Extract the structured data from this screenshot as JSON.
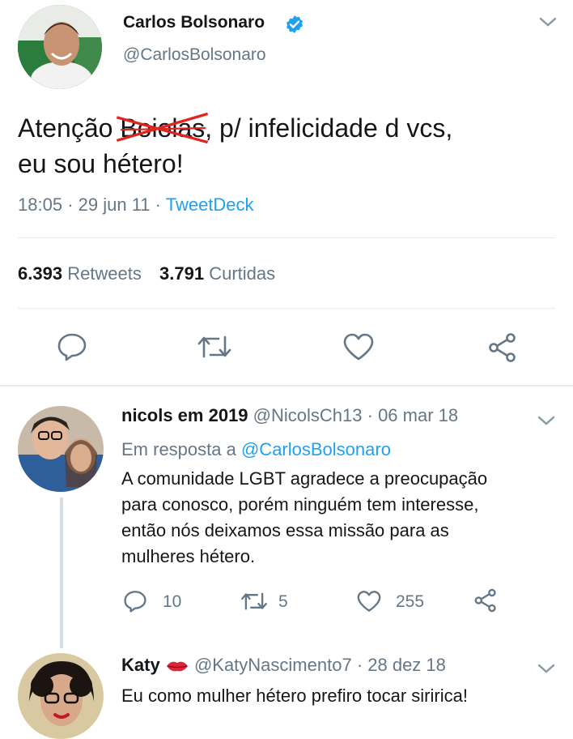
{
  "colors": {
    "accent": "#1da1f2",
    "muted": "#657786",
    "divider": "#e6ecf0",
    "strike": "#e0241f"
  },
  "main_tweet": {
    "author_name": "Carlos Bolsonaro",
    "verified": true,
    "handle": "@CarlosBolsonaro",
    "text_before": "Atenção ",
    "text_struck": "Boiolas",
    "text_after": ", p/ infelicidade d vcs,",
    "text_line2": "eu sou hétero!",
    "time": "18:05",
    "date": "29 jun 11",
    "sep": "·",
    "client": "TweetDeck",
    "retweets_count": "6.393",
    "retweets_label": "Retweets",
    "likes_count": "3.791",
    "likes_label": "Curtidas",
    "icons": [
      "reply-icon",
      "retweet-icon",
      "like-icon",
      "share-icon"
    ]
  },
  "replies": [
    {
      "author_name": "nicols em 2019",
      "handle": "@NicolsCh13",
      "date": "· 06 mar 18",
      "reply_prefix": "Em resposta a",
      "reply_handle": "@CarlosBolsonaro",
      "text_lines": [
        "A comunidade LGBT agradece a preocupação",
        "para conosco, porém ninguém tem interesse,",
        "então nós deixamos essa missão para as",
        "mulheres hétero."
      ],
      "reply_count": "10",
      "retweet_count": "5",
      "like_count": "255"
    },
    {
      "author_name": "Katy",
      "handle": "@KatyNascimento7",
      "date": "· 28 dez 18",
      "text": "Eu como mulher hétero prefiro tocar siririca!"
    }
  ]
}
